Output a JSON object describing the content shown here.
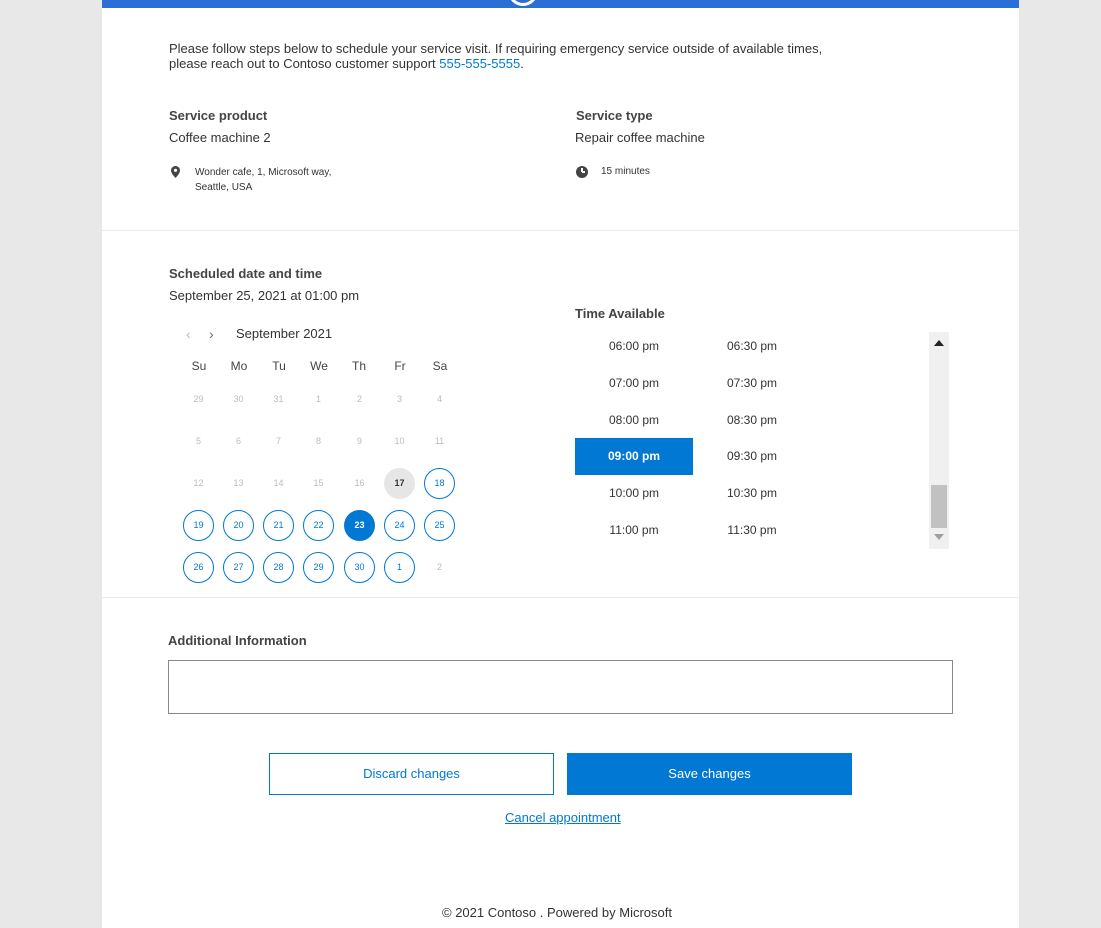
{
  "intro": {
    "line1": "Please follow steps below to schedule your service visit. If requiring emergency service outside of available times,",
    "line2_prefix": "please reach out to Contoso customer support ",
    "phone": "555-555-5555",
    "line2_suffix": "."
  },
  "service_product": {
    "label": "Service product",
    "value": "Coffee machine 2",
    "address_line1": "Wonder cafe, 1, Microsoft way,",
    "address_line2": "Seattle, USA",
    "icon": "location-pin-icon"
  },
  "service_type": {
    "label": "Service type",
    "value": "Repair coffee machine",
    "duration": "15 minutes",
    "icon": "clock-icon"
  },
  "schedule": {
    "label": "Scheduled date and time",
    "value": "September 25, 2021 at 01:00 pm"
  },
  "calendar": {
    "prev_icon": "‹",
    "next_icon": "›",
    "month_label": "September 2021",
    "weekdays": [
      "Su",
      "Mo",
      "Tu",
      "We",
      "Th",
      "Fr",
      "Sa"
    ],
    "weeks": [
      [
        {
          "d": "29",
          "s": "disabled"
        },
        {
          "d": "30",
          "s": "disabled"
        },
        {
          "d": "31",
          "s": "disabled"
        },
        {
          "d": "1",
          "s": "disabled"
        },
        {
          "d": "2",
          "s": "disabled"
        },
        {
          "d": "3",
          "s": "disabled"
        },
        {
          "d": "4",
          "s": "disabled"
        }
      ],
      [
        {
          "d": "5",
          "s": "disabled"
        },
        {
          "d": "6",
          "s": "disabled"
        },
        {
          "d": "7",
          "s": "disabled"
        },
        {
          "d": "8",
          "s": "disabled"
        },
        {
          "d": "9",
          "s": "disabled"
        },
        {
          "d": "10",
          "s": "disabled"
        },
        {
          "d": "11",
          "s": "disabled"
        }
      ],
      [
        {
          "d": "12",
          "s": "disabled"
        },
        {
          "d": "13",
          "s": "disabled"
        },
        {
          "d": "14",
          "s": "disabled"
        },
        {
          "d": "15",
          "s": "disabled"
        },
        {
          "d": "16",
          "s": "disabled"
        },
        {
          "d": "17",
          "s": "today"
        },
        {
          "d": "18",
          "s": "avail"
        }
      ],
      [
        {
          "d": "19",
          "s": "avail"
        },
        {
          "d": "20",
          "s": "avail"
        },
        {
          "d": "21",
          "s": "avail"
        },
        {
          "d": "22",
          "s": "avail"
        },
        {
          "d": "23",
          "s": "selected"
        },
        {
          "d": "24",
          "s": "avail"
        },
        {
          "d": "25",
          "s": "avail"
        }
      ],
      [
        {
          "d": "26",
          "s": "avail"
        },
        {
          "d": "27",
          "s": "avail"
        },
        {
          "d": "28",
          "s": "avail"
        },
        {
          "d": "29",
          "s": "avail"
        },
        {
          "d": "30",
          "s": "avail"
        },
        {
          "d": "1",
          "s": "avail"
        },
        {
          "d": "2",
          "s": "disabled"
        }
      ]
    ]
  },
  "time": {
    "label": "Time Available",
    "slots": [
      [
        "06:00 pm",
        "06:30 pm"
      ],
      [
        "07:00 pm",
        "07:30 pm"
      ],
      [
        "08:00 pm",
        "08:30 pm"
      ],
      [
        "09:00 pm",
        "09:30 pm"
      ],
      [
        "10:00 pm",
        "10:30 pm"
      ],
      [
        "11:00 pm",
        "11:30 pm"
      ]
    ],
    "selected": "09:00 pm"
  },
  "additional": {
    "label": "Additional Information",
    "value": ""
  },
  "actions": {
    "discard": "Discard changes",
    "save": "Save changes",
    "cancel": "Cancel appointment"
  },
  "footer": {
    "text": "© 2021 Contoso . Powered by Microsoft"
  },
  "colors": {
    "accent": "#0078d4",
    "topbar": "#2b6fd6",
    "background": "#e8e8e8"
  }
}
